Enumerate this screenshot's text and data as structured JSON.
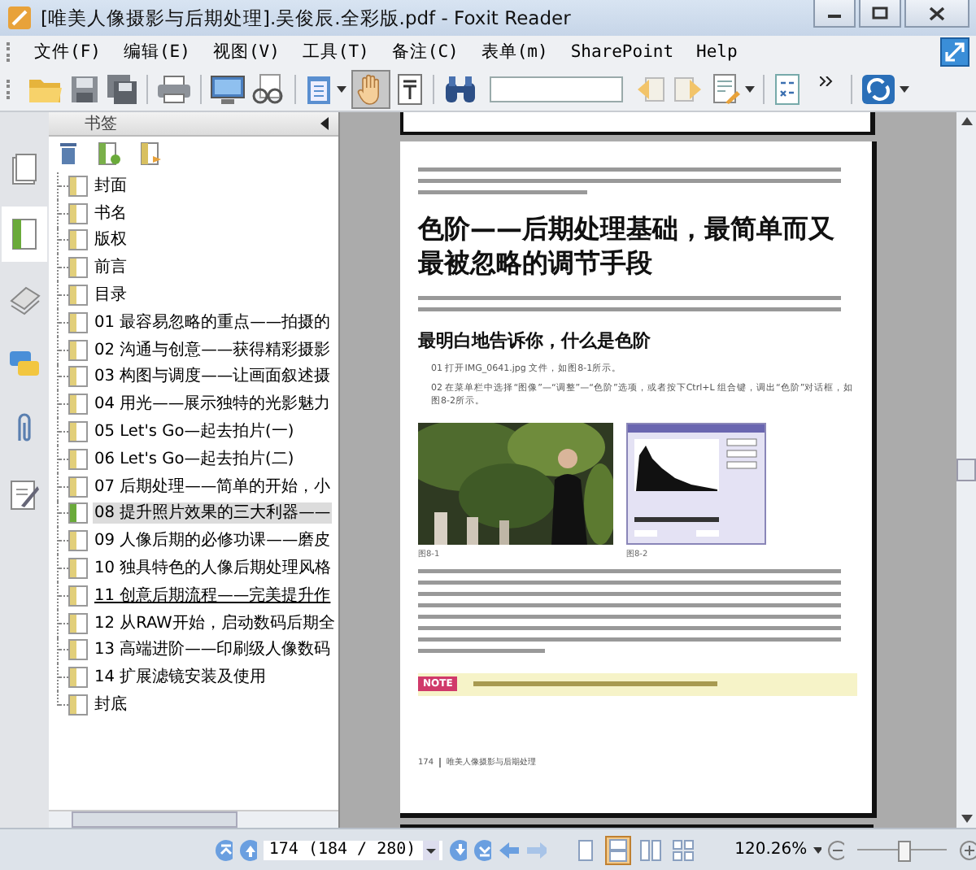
{
  "window": {
    "title": "[唯美人像摄影与后期处理].吴俊辰.全彩版.pdf - Foxit Reader"
  },
  "menu": [
    "文件(F)",
    "编辑(E)",
    "视图(V)",
    "工具(T)",
    "备注(C)",
    "表单(m)",
    "SharePoint",
    "Help"
  ],
  "toolbar": {
    "hand_tool": {
      "selected": true
    }
  },
  "sidebar": {
    "title": "书签",
    "tabs": [
      {
        "selected": false
      },
      {
        "selected": true
      },
      {
        "selected": false
      },
      {
        "selected": false
      },
      {
        "selected": false
      },
      {
        "selected": false
      }
    ],
    "bookmarks": [
      {
        "label": "封面",
        "selected": false,
        "hovered": false
      },
      {
        "label": "书名",
        "selected": false,
        "hovered": false
      },
      {
        "label": "版权",
        "selected": false,
        "hovered": false
      },
      {
        "label": "前言",
        "selected": false,
        "hovered": false
      },
      {
        "label": "目录",
        "selected": false,
        "hovered": false
      },
      {
        "label": "01 最容易忽略的重点——拍摄的",
        "selected": false,
        "hovered": false
      },
      {
        "label": "02 沟通与创意——获得精彩摄影",
        "selected": false,
        "hovered": false
      },
      {
        "label": "03 构图与调度——让画面叙述摄",
        "selected": false,
        "hovered": false
      },
      {
        "label": "04 用光——展示独特的光影魅力",
        "selected": false,
        "hovered": false
      },
      {
        "label": "05 Let's Go—起去拍片(一)",
        "selected": false,
        "hovered": false
      },
      {
        "label": "06 Let's Go—起去拍片(二)",
        "selected": false,
        "hovered": false
      },
      {
        "label": "07 后期处理——简单的开始，小",
        "selected": false,
        "hovered": false
      },
      {
        "label": "08 提升照片效果的三大利器——",
        "selected": true,
        "hovered": false
      },
      {
        "label": "09 人像后期的必修功课——磨皮",
        "selected": false,
        "hovered": false
      },
      {
        "label": "10 独具特色的人像后期处理风格",
        "selected": false,
        "hovered": false
      },
      {
        "label": "11 创意后期流程——完美提升作",
        "selected": false,
        "hovered": true
      },
      {
        "label": "12 从RAW开始，启动数码后期全",
        "selected": false,
        "hovered": false
      },
      {
        "label": "13 高端进阶——印刷级人像数码",
        "selected": false,
        "hovered": false
      },
      {
        "label": "14 扩展滤镜安装及使用",
        "selected": false,
        "hovered": false
      },
      {
        "label": "封底",
        "selected": false,
        "hovered": false
      }
    ]
  },
  "document": {
    "heading": "色阶——后期处理基础，最简单而又最被忽略的调节手段",
    "subheading": "最明白地告诉你，什么是色阶",
    "steps": [
      "01 打开IMG_0641.jpg 文件，如图8-1所示。",
      "02 在菜单栏中选择“图像”—“调整”—“色阶”选项，或者按下Ctrl+L 组合键，调出“色阶”对话框，如图8-2所示。"
    ],
    "captions": [
      "图8-1",
      "图8-2"
    ],
    "note_label": "NOTE",
    "footer_page": "174",
    "footer_title": "唯美人像摄影与后期处理"
  },
  "status": {
    "page_field": "174 (184 / 280)",
    "zoom": "120.26%",
    "zoom_slider": {
      "level": 0.53
    },
    "view_modes": [
      {
        "selected": false
      },
      {
        "selected": true
      },
      {
        "selected": false
      },
      {
        "selected": false
      }
    ]
  }
}
